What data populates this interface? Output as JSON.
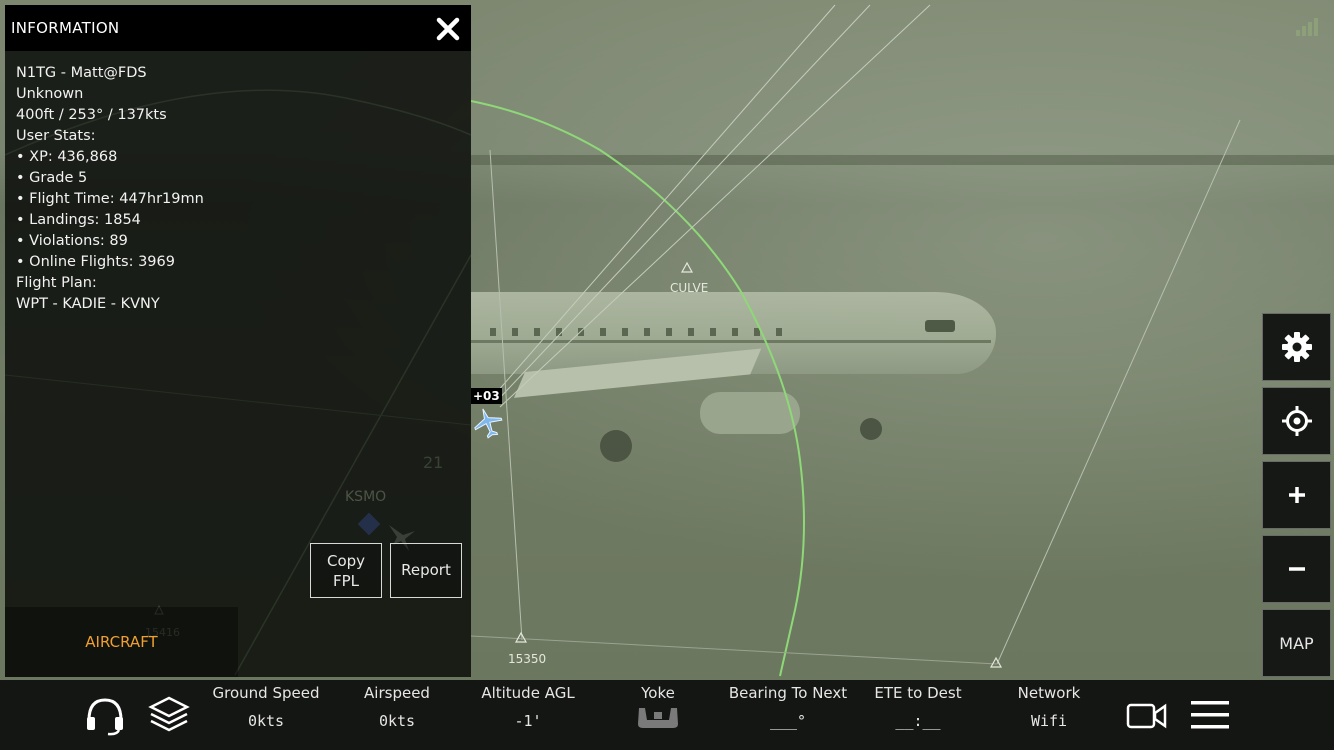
{
  "info_panel": {
    "title": "INFORMATION",
    "lines": [
      "N1TG - Matt@FDS",
      "Unknown",
      "400ft / 253° / 137kts",
      "User Stats:",
      "• XP: 436,868",
      "•  Grade 5",
      "•  Flight Time: 447hr19mn",
      "•  Landings: 1854",
      "• Violations: 89",
      "•  Online Flights: 3969",
      "Flight Plan:",
      "WPT - KADIE - KVNY"
    ],
    "copy_fpl_line1": "Copy",
    "copy_fpl_line2": "FPL",
    "report_label": "Report",
    "aircraft_tab_label": "AIRCRAFT"
  },
  "map": {
    "waypoint_culve": "CULVE",
    "waypoint_15350": "15350",
    "airport_ksmo": "KSMO",
    "runway_label": "21",
    "faint_label": "15416",
    "aircraft_tag": "+03"
  },
  "right_controls": {
    "map_label": "MAP"
  },
  "bottom_bar": {
    "stats": [
      {
        "label": "Ground Speed",
        "value": "0kts"
      },
      {
        "label": "Airspeed",
        "value": "0kts"
      },
      {
        "label": "Altitude AGL",
        "value": "-1'"
      },
      {
        "label": "Yoke",
        "value": ""
      },
      {
        "label": "Bearing To Next",
        "value": "___°"
      },
      {
        "label": "ETE to Dest",
        "value": "__:__"
      },
      {
        "label": "Network",
        "value": "Wifi"
      }
    ]
  },
  "colors": {
    "accent_orange": "#f0a030",
    "route_green": "#8ed878",
    "aircraft_blue": "#7fb8ec"
  }
}
